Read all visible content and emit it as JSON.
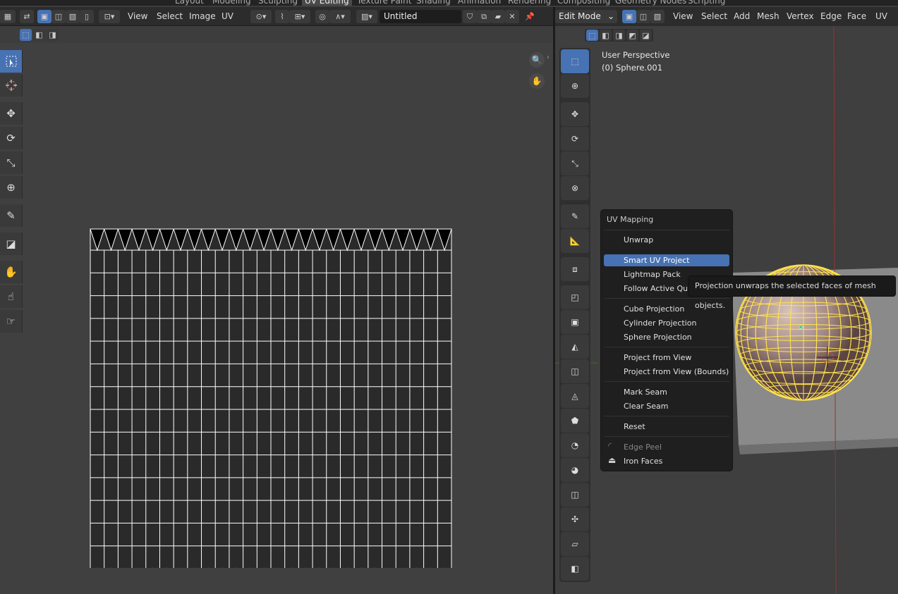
{
  "workspace_tabs": [
    "Layout",
    "Modeling",
    "Sculpting",
    "UV Editing",
    "Texture Paint",
    "Shading",
    "Animation",
    "Rendering",
    "Compositing",
    "Geometry Nodes",
    "Scripting"
  ],
  "uv_header": {
    "menus": [
      "View",
      "Select",
      "Image",
      "UV"
    ],
    "image_name": "Untitled"
  },
  "v3d_header": {
    "mode": "Edit Mode",
    "menus": [
      "View",
      "Select",
      "Add",
      "Mesh",
      "Vertex",
      "Edge",
      "Face",
      "UV"
    ]
  },
  "viewport": {
    "perspective": "User Perspective",
    "object": "(0) Sphere.001"
  },
  "uv_menu": {
    "title": "UV Mapping",
    "items": [
      "Unwrap",
      "Smart UV Project",
      "Lightmap Pack",
      "Follow Active Quads",
      "Cube Projection",
      "Cylinder Projection",
      "Sphere Projection",
      "Project from View",
      "Project from View (Bounds)",
      "Mark Seam",
      "Clear Seam",
      "Reset",
      "Edge Peel",
      "Iron Faces"
    ],
    "highlighted": "Smart UV Project",
    "disabled": [
      "Edge Peel"
    ]
  },
  "tooltip": "Projection unwraps the selected faces of mesh objects.",
  "colors": {
    "accent": "#4772b3",
    "vertex": "#ffe34d",
    "mesh_surface": "#a08784"
  },
  "uv_grid": {
    "columns": 26,
    "rows": 16
  }
}
